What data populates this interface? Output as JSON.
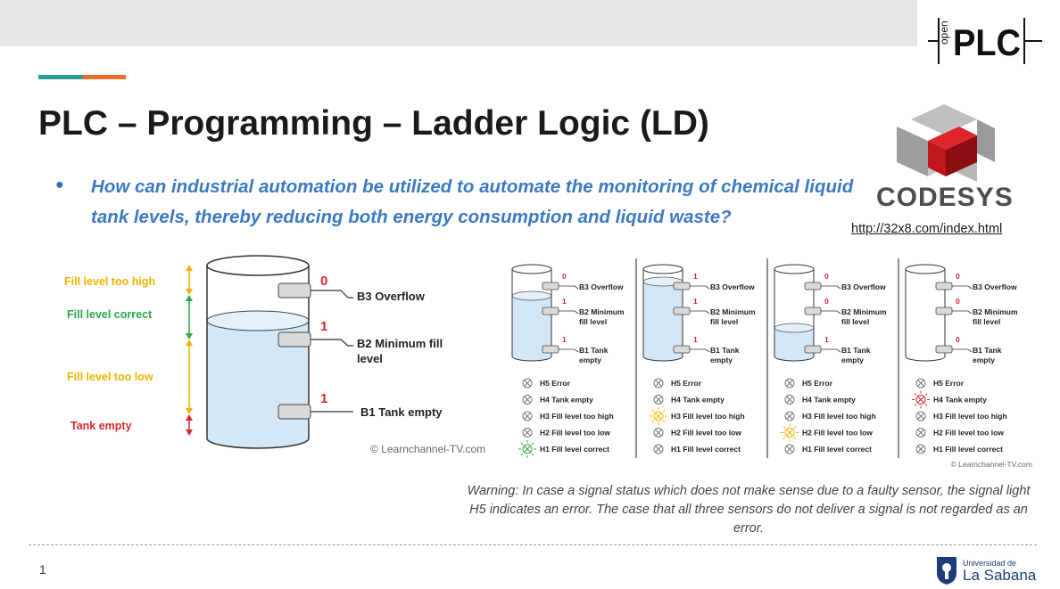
{
  "slide": {
    "title": "PLC – Programming – Ladder Logic (LD)",
    "question": "How can industrial automation be utilized to automate the monitoring of chemical liquid tank levels, thereby reducing both energy consumption and liquid waste?",
    "page_number": "1",
    "accent_colors": [
      "#2a9d8f",
      "#e76f28"
    ]
  },
  "logos": {
    "openplc_small": "open",
    "openplc_big": "PLC",
    "codesys_name": "CODESYS",
    "codesys_link": "http://32x8.com/index.html",
    "university_small": "Universidad de",
    "university_big": "La Sabana"
  },
  "big_diagram": {
    "levels": [
      {
        "label": "Fill level too high",
        "color": "#f0b400"
      },
      {
        "label": "Fill level correct",
        "color": "#2aa84a"
      },
      {
        "label": "Fill level too low",
        "color": "#f0b400"
      },
      {
        "label": "Tank empty",
        "color": "#d9262c"
      }
    ],
    "sensors": [
      {
        "value": "0",
        "label_line1": "B3 Overflow",
        "label_line2": ""
      },
      {
        "value": "1",
        "label_line1": "B2 Minimum fill",
        "label_line2": "level"
      },
      {
        "value": "1",
        "label_line1": "B1 Tank empty",
        "label_line2": ""
      }
    ],
    "copyright": "© Learnchannel-TV.com"
  },
  "small_diagrams": {
    "copyright": "© Learnchannel-TV.com",
    "panels": [
      {
        "sensors": [
          {
            "value": "0",
            "line1": "B3 Overflow",
            "line2": ""
          },
          {
            "value": "1",
            "line1": "B2 Minimum",
            "line2": "fill level"
          },
          {
            "value": "1",
            "line1": "B1 Tank",
            "line2": "empty"
          }
        ],
        "lights": [
          "H5 Error",
          "H4 Tank empty",
          "H3 Fill level too high",
          "H2 Fill level too low",
          "H1 Fill level correct"
        ],
        "active_light": 4,
        "active_color": "#2aa84a"
      },
      {
        "sensors": [
          {
            "value": "1",
            "line1": "B3 Overflow",
            "line2": ""
          },
          {
            "value": "1",
            "line1": "B2 Minimum",
            "line2": "fill level"
          },
          {
            "value": "1",
            "line1": "B1 Tank",
            "line2": "empty"
          }
        ],
        "lights": [
          "H5 Error",
          "H4 Tank empty",
          "H3 Fill level too high",
          "H2 Fill level too low",
          "H1 Fill level correct"
        ],
        "active_light": 2,
        "active_color": "#f0b400"
      },
      {
        "sensors": [
          {
            "value": "0",
            "line1": "B3 Overflow",
            "line2": ""
          },
          {
            "value": "0",
            "line1": "B2 Minimum",
            "line2": "fill level"
          },
          {
            "value": "1",
            "line1": "B1 Tank",
            "line2": "empty"
          }
        ],
        "lights": [
          "H5 Error",
          "H4 Tank empty",
          "H3 Fill level too high",
          "H2 Fill level too low",
          "H1 Fill level correct"
        ],
        "active_light": 3,
        "active_color": "#f0b400"
      },
      {
        "sensors": [
          {
            "value": "0",
            "line1": "B3 Overflow",
            "line2": ""
          },
          {
            "value": "0",
            "line1": "B2 Minimum",
            "line2": "fill level"
          },
          {
            "value": "0",
            "line1": "B1 Tank",
            "line2": "empty"
          }
        ],
        "lights": [
          "H5 Error",
          "H4 Tank empty",
          "H3 Fill level too high",
          "H2 Fill level too low",
          "H1 Fill level correct"
        ],
        "active_light": 1,
        "active_color": "#d9262c"
      }
    ]
  },
  "warning": "Warning: In case a signal status which does not make sense due to a faulty sensor, the signal light H5 indicates an error. The case that all three sensors do not deliver a signal is not regarded as an error."
}
